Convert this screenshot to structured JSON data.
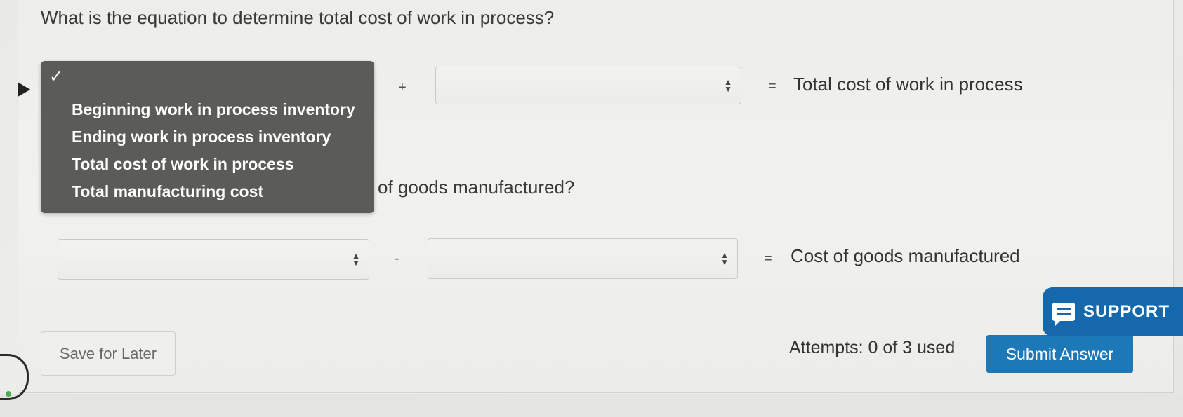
{
  "question1": {
    "text": "What is the equation to determine total cost of work in process?"
  },
  "equation1": {
    "operator": "+",
    "equals": "=",
    "result": "Total cost of work in process",
    "select1_value": "",
    "select2_value": ""
  },
  "dropdown": {
    "check_mark": "✓",
    "options": [
      "Beginning work in process inventory",
      "Ending work in process inventory",
      "Total cost of work in process",
      "Total manufacturing cost"
    ]
  },
  "question2": {
    "visible_text": "of goods manufactured?"
  },
  "equation2": {
    "operator": "-",
    "equals": "=",
    "result": "Cost of goods manufactured",
    "select1_value": "",
    "select2_value": ""
  },
  "footer": {
    "save_label": "Save for Later",
    "attempts_text": "Attempts: 0 of 3 used",
    "submit_label": "Submit Answer"
  },
  "support": {
    "label": "SUPPORT",
    "icon": "chat-icon"
  },
  "colors": {
    "dropdown_bg": "#5b5b58",
    "submit_bg": "#1d78b7",
    "support_bg": "#1668ad",
    "page_bg": "#ededea"
  }
}
